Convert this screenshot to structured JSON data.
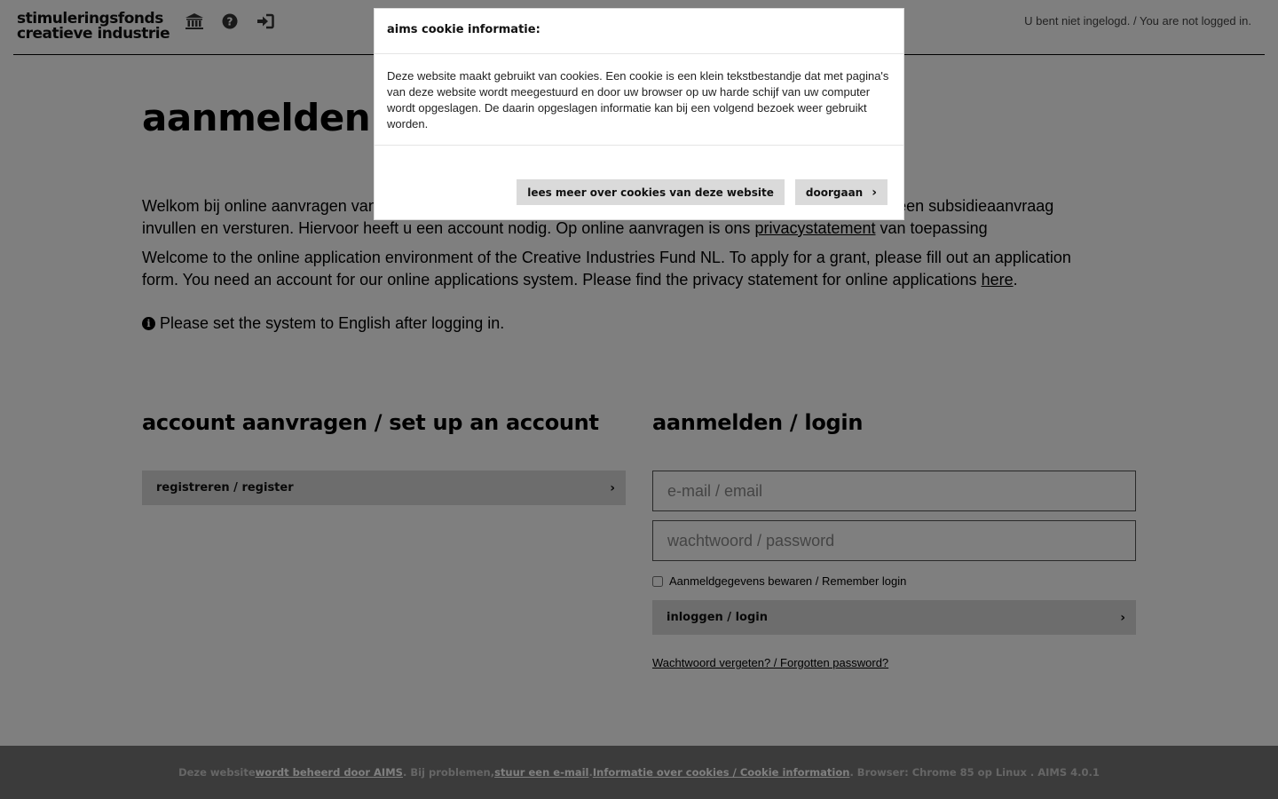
{
  "header": {
    "logo_line1": "stimuleringsfonds",
    "logo_line2": "creatieve industrie",
    "icons": [
      "institution-icon",
      "question-circle-icon",
      "sign-in-icon"
    ],
    "login_status": "U bent niet ingelogd. / You are not logged in."
  },
  "main": {
    "title": "aanmelden / login",
    "intro_nl_text": "Welkom bij online aanvragen van het Stimuleringsfonds Creatieve Industrie. Hier kunt u een formulier voor een subsidieaanvraag invullen en versturen. Hiervoor heeft u een account nodig. Op online aanvragen is ons ",
    "intro_nl_link": "privacystatement",
    "intro_nl_suffix": " van toepassing",
    "intro_en_text": "Welcome to the online application environment of the Creative Industries Fund NL. To apply for a grant, please fill out an application form. You need an account for our online applications system. Please find the privacy statement for online applications ",
    "intro_en_link": "here",
    "intro_en_suffix": ".",
    "notice": "Please set the system to English after logging in."
  },
  "register": {
    "title": "account aanvragen / set up an account",
    "button_label": "registreren / register"
  },
  "login": {
    "title": "aanmelden / login",
    "email_placeholder": "e-mail / email",
    "password_placeholder": "wachtwoord / password",
    "remember_label": "Aanmeldgegevens bewaren / Remember login",
    "remember_checked": false,
    "button_label": "inloggen / login",
    "forgot_label": "Wachtwoord vergeten? / Forgotten password?"
  },
  "footer": {
    "text1": "Deze website ",
    "link1": "wordt beheerd door AIMS",
    "text2": ". Bij problemen, ",
    "link2": "stuur een e-mail",
    "text3": ". ",
    "link3": "Informatie over cookies / Cookie information",
    "text4": ". Browser: Chrome 85 op Linux . AIMS 4.0.1"
  },
  "cookie_modal": {
    "title": "aims cookie informatie:",
    "body": "Deze website maakt gebruikt van cookies. Een cookie is een klein tekstbestandje dat met pagina's van deze website wordt meegestuurd en door uw browser op uw harde schijf van uw computer wordt opgeslagen. De daarin opgeslagen informatie kan bij een volgend bezoek weer gebruikt worden.",
    "more_button": "lees meer over cookies van deze website",
    "continue_button": "doorgaan"
  },
  "colors": {
    "overlay": "rgba(0,0,0,0.5)",
    "button_bg": "#dadada",
    "footer_bg": "#777777"
  }
}
